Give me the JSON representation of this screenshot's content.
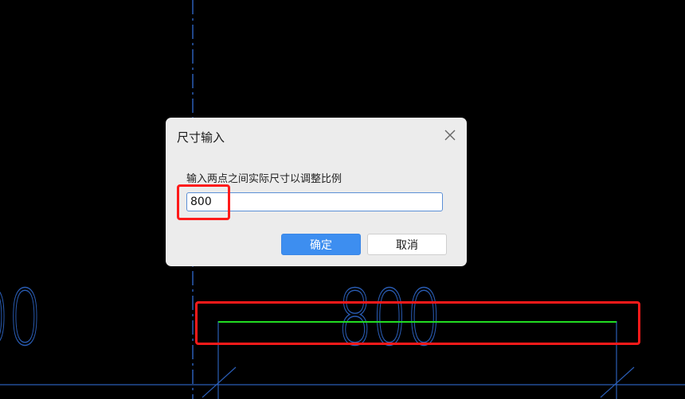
{
  "canvas": {
    "dimension_text": "800",
    "partial_dimension_text": "00"
  },
  "dialog": {
    "title": "尺寸输入",
    "prompt": "输入两点之间实际尺寸以调整比例",
    "input_value": "800",
    "ok_label": "确定",
    "cancel_label": "取消"
  },
  "colors": {
    "background": "#000000",
    "cad_blue": "#2a5db5",
    "dimension_green": "#22dd22",
    "highlight_red": "#ff1a1a",
    "primary_button": "#3d8ef0"
  }
}
